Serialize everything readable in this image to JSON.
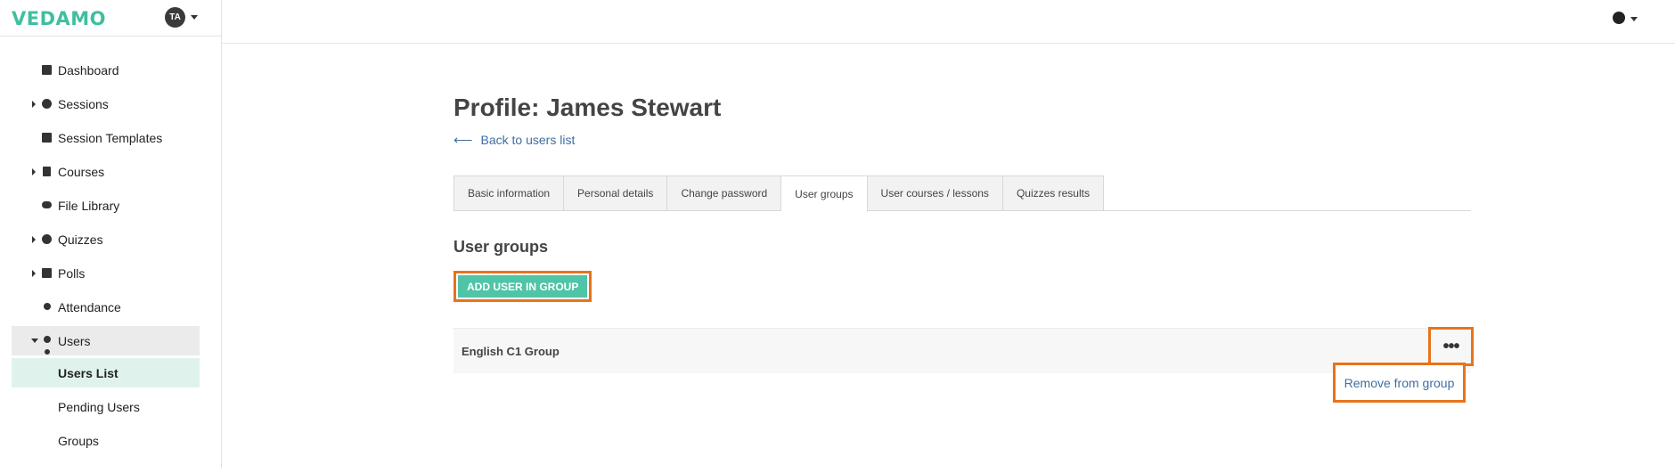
{
  "sidebar": {
    "logo": "VEDAMO",
    "avatar_initials": "TA",
    "items": [
      {
        "label": "Dashboard",
        "icon": "dashboard-icon",
        "expandable": false
      },
      {
        "label": "Sessions",
        "icon": "play-icon",
        "expandable": true
      },
      {
        "label": "Session Templates",
        "icon": "template-icon",
        "expandable": false
      },
      {
        "label": "Courses",
        "icon": "book-icon",
        "expandable": true
      },
      {
        "label": "File Library",
        "icon": "cloud-upload-icon",
        "expandable": false
      },
      {
        "label": "Quizzes",
        "icon": "question-icon",
        "expandable": true
      },
      {
        "label": "Polls",
        "icon": "poll-icon",
        "expandable": true
      },
      {
        "label": "Attendance",
        "icon": "user-clock-icon",
        "expandable": false
      },
      {
        "label": "Users",
        "icon": "users-icon",
        "expandable": true,
        "expanded": true
      },
      {
        "label": "Users List",
        "sub": true,
        "active": true
      },
      {
        "label": "Pending Users",
        "sub": true
      },
      {
        "label": "Groups",
        "sub": true
      }
    ]
  },
  "topbar": {
    "language_icon": "globe-icon"
  },
  "main": {
    "title": "Profile: James Stewart",
    "back_link": "Back to users list",
    "tabs": [
      {
        "label": "Basic information"
      },
      {
        "label": "Personal details"
      },
      {
        "label": "Change password"
      },
      {
        "label": "User groups",
        "active": true
      },
      {
        "label": "User courses / lessons"
      },
      {
        "label": "Quizzes results"
      }
    ],
    "section_title": "User groups",
    "add_button": "ADD USER IN GROUP",
    "groups": [
      {
        "name": "English C1 Group"
      }
    ],
    "menu_dots": "•••",
    "remove_action": "Remove from group"
  },
  "colors": {
    "accent": "#4fc4a6",
    "highlight": "#e8731c",
    "link": "#3f6ea2",
    "active_sub_bg": "#dff3ec"
  }
}
